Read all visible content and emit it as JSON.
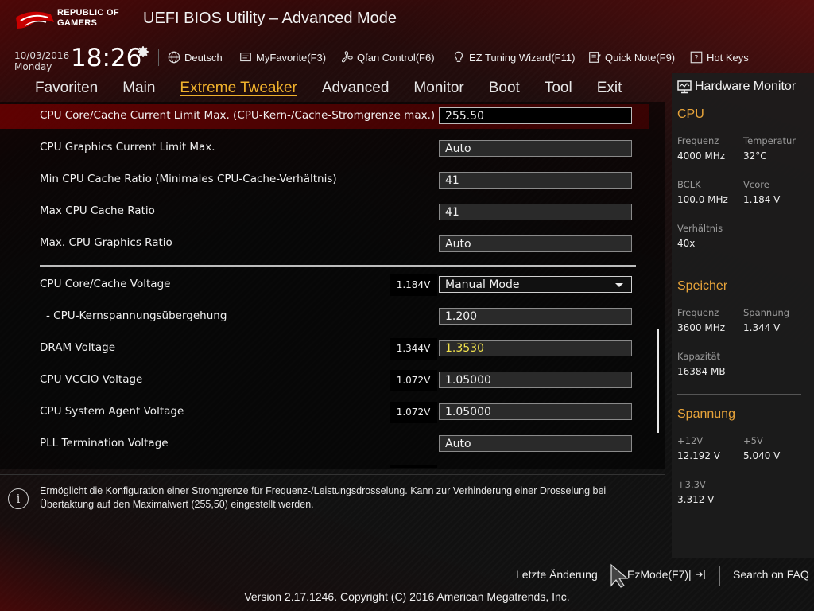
{
  "header": {
    "logo_text_1": "REPUBLIC OF",
    "logo_text_2": "GAMERS",
    "title": "UEFI BIOS Utility – Advanced Mode",
    "date": "10/03/2016",
    "day": "Monday",
    "time": "18:26"
  },
  "toolbar": [
    {
      "label": "Deutsch",
      "icon": "globe-icon"
    },
    {
      "label": "MyFavorite(F3)",
      "icon": "favorite-icon"
    },
    {
      "label": "Qfan Control(F6)",
      "icon": "fan-icon"
    },
    {
      "label": "EZ Tuning Wizard(F11)",
      "icon": "bulb-icon"
    },
    {
      "label": "Quick Note(F9)",
      "icon": "note-icon"
    },
    {
      "label": "Hot Keys",
      "icon": "question-icon"
    }
  ],
  "menu": [
    {
      "label": "Favoriten"
    },
    {
      "label": "Main"
    },
    {
      "label": "Extreme Tweaker",
      "active": true
    },
    {
      "label": "Advanced"
    },
    {
      "label": "Monitor"
    },
    {
      "label": "Boot"
    },
    {
      "label": "Tool"
    },
    {
      "label": "Exit"
    }
  ],
  "settings": [
    {
      "label": "CPU Core/Cache Current Limit Max. (CPU-Kern-/Cache-Stromgrenze max.)",
      "value": "255.50"
    },
    {
      "label": "CPU Graphics Current Limit Max.",
      "value": "Auto"
    },
    {
      "label": "Min CPU Cache Ratio (Minimales CPU-Cache-Verhältnis)",
      "value": "41"
    },
    {
      "label": "Max CPU Cache Ratio",
      "value": "41"
    },
    {
      "label": "Max. CPU Graphics Ratio",
      "value": "Auto"
    },
    {
      "label": "CPU Core/Cache Voltage",
      "voltage": "1.184V",
      "value": "Manual Mode"
    },
    {
      "label": "- CPU-Kernspannungsübergehung",
      "value": "1.200"
    },
    {
      "label": "DRAM Voltage",
      "voltage": "1.344V",
      "value": "1.3530"
    },
    {
      "label": "CPU VCCIO Voltage",
      "voltage": "1.072V",
      "value": "1.05000"
    },
    {
      "label": "CPU System Agent Voltage",
      "voltage": "1.072V",
      "value": "1.05000"
    },
    {
      "label": "PLL Termination Voltage",
      "value": "Auto"
    }
  ],
  "help": {
    "text": "Ermöglicht die Konfiguration einer Stromgrenze für Frequenz-/Leistungsdrosselung. Kann zur Verhinderung einer Drosselung bei Übertaktung auf den Maximalwert (255,50) eingestellt werden."
  },
  "hardware_monitor": {
    "title": "Hardware Monitor",
    "cpu": {
      "heading": "CPU",
      "freq_label": "Frequenz",
      "freq": "4000 MHz",
      "temp_label": "Temperatur",
      "temp": "32°C",
      "bclk_label": "BCLK",
      "bclk": "100.0 MHz",
      "vcore_label": "Vcore",
      "vcore": "1.184 V",
      "ratio_label": "Verhältnis",
      "ratio": "40x"
    },
    "memory": {
      "heading": "Speicher",
      "freq_label": "Frequenz",
      "freq": "3600 MHz",
      "volt_label": "Spannung",
      "volt": "1.344 V",
      "cap_label": "Kapazität",
      "cap": "16384 MB"
    },
    "voltage": {
      "heading": "Spannung",
      "v12_label": "+12V",
      "v12": "12.192 V",
      "v5_label": "+5V",
      "v5": "5.040 V",
      "v33_label": "+3.3V",
      "v33": "3.312 V"
    }
  },
  "footer": {
    "last_change": "Letzte Änderung",
    "ezmode": "EzMode(F7)|",
    "search": "Search on FAQ",
    "copyright": "Version 2.17.1246. Copyright (C) 2016 American Megatrends, Inc."
  },
  "colors": {
    "accent": "#f0b12c",
    "section": "#e8a43a",
    "highlight": "#7a0000",
    "dram_value": "#f2e34c"
  }
}
